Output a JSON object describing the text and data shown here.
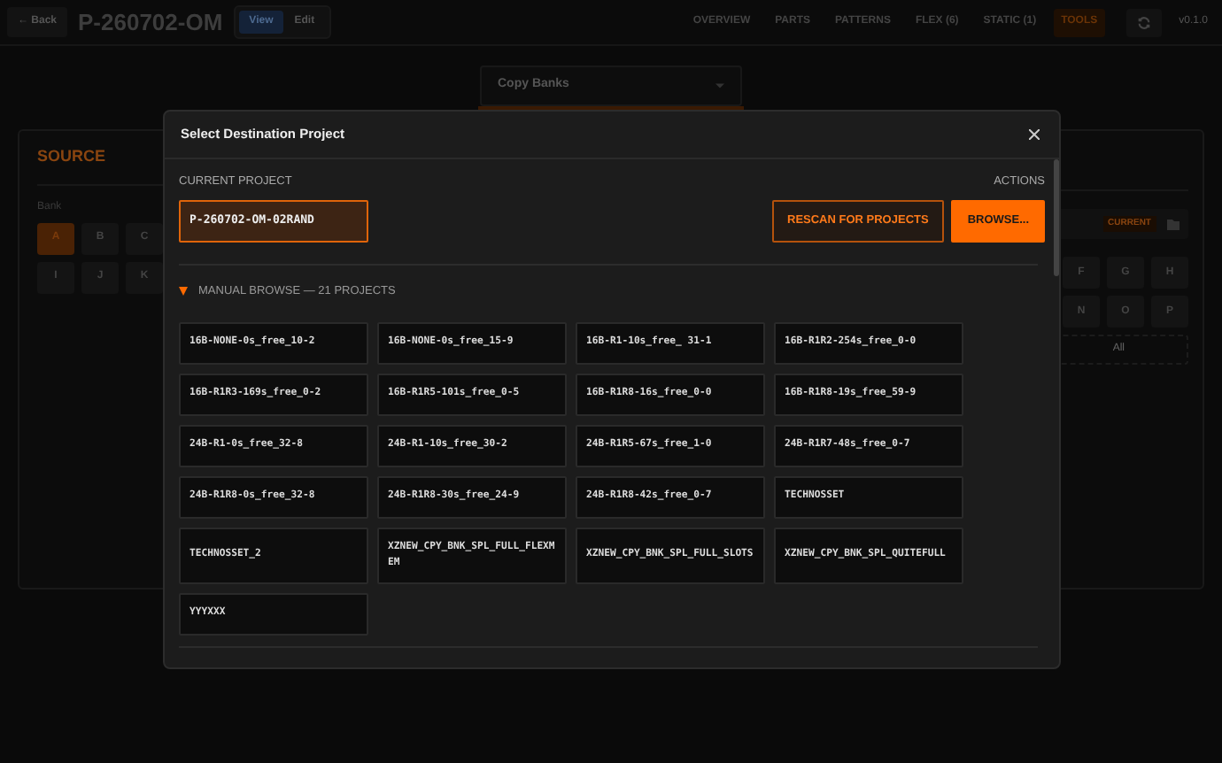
{
  "header": {
    "back_button": "← Back",
    "title": "P-260702-OM",
    "mode_toggle": [
      {
        "label": "View",
        "selected": true
      },
      {
        "label": "Edit",
        "selected": false
      }
    ],
    "nav": [
      {
        "label": "OVERVIEW",
        "selected": false
      },
      {
        "label": "PARTS",
        "selected": false
      },
      {
        "label": "PATTERNS",
        "selected": false
      },
      {
        "label": "FLEX (6)",
        "selected": false
      },
      {
        "label": "STATIC (1)",
        "selected": false
      },
      {
        "label": "TOOLS",
        "selected": true
      }
    ],
    "version": "v0.1.0"
  },
  "operation_select": {
    "value": "Copy Banks"
  },
  "source_panel": {
    "title": "SOURCE",
    "bank_label": "Bank",
    "bank_rows": [
      [
        {
          "label": "A",
          "selected": true
        },
        {
          "label": "B",
          "selected": false
        },
        {
          "label": "C",
          "selected": false
        }
      ],
      [
        {
          "label": "I",
          "selected": false
        },
        {
          "label": "J",
          "selected": false
        },
        {
          "label": "K",
          "selected": false
        }
      ]
    ]
  },
  "destination_panel": {
    "badge": "CURRENT",
    "bank_rows": [
      [
        {
          "label": "F",
          "selected": false
        },
        {
          "label": "G",
          "selected": false
        },
        {
          "label": "H",
          "selected": false
        }
      ],
      [
        {
          "label": "N",
          "selected": false
        },
        {
          "label": "O",
          "selected": false
        },
        {
          "label": "P",
          "selected": false
        }
      ]
    ],
    "all_button": "All"
  },
  "dialog": {
    "title": "Select Destination Project",
    "current_project_label": "CURRENT PROJECT",
    "current_project": "P-260702-OM-02RAND",
    "actions_label": "ACTIONS",
    "buttons": [
      {
        "label": "RESCAN FOR PROJECTS",
        "kind": "outline"
      },
      {
        "label": "BROWSE...",
        "kind": "primary"
      }
    ],
    "browse_header": "MANUAL BROWSE — 21 PROJECTS",
    "expanded": true,
    "projects": [
      "16B-NONE-0s_free_10-2",
      "16B-NONE-0s_free_15-9",
      "16B-R1-10s_free_ 31-1",
      "16B-R1R2-254s_free_0-0",
      "16B-R1R3-169s_free_0-2",
      "16B-R1R5-101s_free_0-5",
      "16B-R1R8-16s_free_0-0",
      "16B-R1R8-19s_free_59-9",
      "24B-R1-0s_free_32-8",
      "24B-R1-10s_free_30-2",
      "24B-R1R5-67s_free_1-0",
      "24B-R1R7-48s_free_0-7",
      "24B-R1R8-0s_free_32-8",
      "24B-R1R8-30s_free_24-9",
      "24B-R1R8-42s_free_0-7",
      "TECHNOSSET",
      "TECHNOSSET_2",
      "XZNEW_CPY_BNK_SPL_FULL_FLEXMEM",
      "XZNEW_CPY_BNK_SPL_FULL_SLOTS",
      "XZNEW_CPY_BNK_SPL_QUITEFULL",
      "YYYXXX"
    ]
  }
}
